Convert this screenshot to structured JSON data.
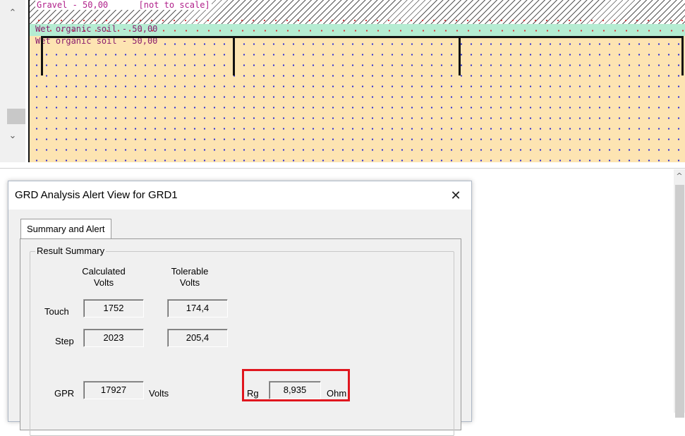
{
  "soil_profile": {
    "gravel_label": "Gravel - 50,00",
    "scale_note": "[not to scale]",
    "wet_soil_label_1": "Wet organic soil - 50,00",
    "wet_soil_label_2": "Wet organic soil - 50,00"
  },
  "dialog": {
    "title": "GRD Analysis Alert View for GRD1",
    "close_glyph": "✕",
    "tab_label": "Summary and Alert",
    "group_title": "Result Summary",
    "calculated_header": "Calculated\nVolts",
    "tolerable_header": "Tolerable\nVolts",
    "touch_label": "Touch",
    "touch_calculated": "1752",
    "touch_tolerable": "174,4",
    "step_label": "Step",
    "step_calculated": "2023",
    "step_tolerable": "205,4",
    "gpr_label": "GPR",
    "gpr_value": "17927",
    "gpr_unit": "Volts",
    "rg_label": "Rg",
    "rg_value": "8,935",
    "rg_unit": "Ohm"
  },
  "colors": {
    "highlight": "#e0161e",
    "sand_fill": "#fde4b2",
    "wet_soil_band": "#b5ecd2"
  }
}
